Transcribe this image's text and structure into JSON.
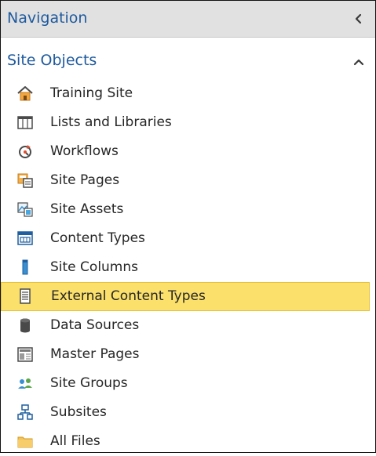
{
  "header": {
    "title": "Navigation",
    "collapse_icon": "chevron-left-icon"
  },
  "section": {
    "title": "Site Objects",
    "toggle_icon": "chevron-up-icon"
  },
  "items": [
    {
      "label": "Training Site",
      "icon": "home-icon"
    },
    {
      "label": "Lists and Libraries",
      "icon": "list-table-icon"
    },
    {
      "label": "Workflows",
      "icon": "workflow-icon"
    },
    {
      "label": "Site Pages",
      "icon": "site-pages-icon"
    },
    {
      "label": "Site Assets",
      "icon": "site-assets-icon"
    },
    {
      "label": "Content Types",
      "icon": "content-types-icon"
    },
    {
      "label": "Site Columns",
      "icon": "site-columns-icon"
    },
    {
      "label": "External Content Types",
      "icon": "external-content-types-icon",
      "selected": true
    },
    {
      "label": "Data Sources",
      "icon": "database-icon"
    },
    {
      "label": "Master Pages",
      "icon": "master-pages-icon"
    },
    {
      "label": "Site Groups",
      "icon": "users-icon"
    },
    {
      "label": "Subsites",
      "icon": "subsites-icon"
    },
    {
      "label": "All Files",
      "icon": "folder-icon"
    }
  ],
  "colors": {
    "header_text": "#1e5a9e",
    "selected_background": "#fbe06b"
  }
}
